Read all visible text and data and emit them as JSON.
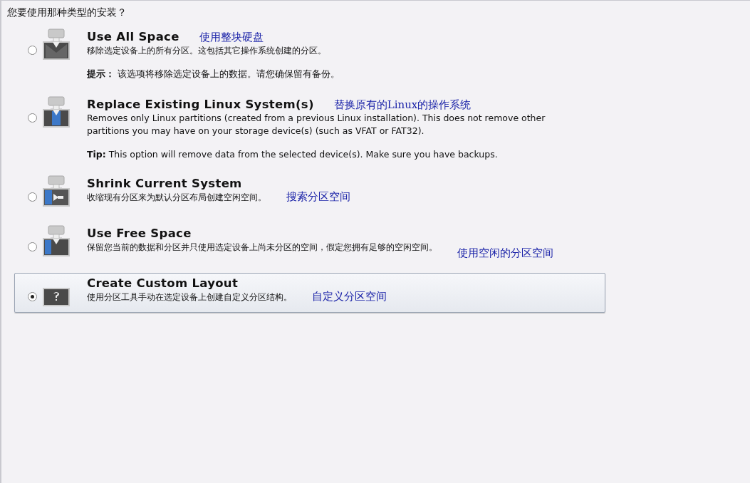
{
  "heading": "您要使用那种类型的安装？",
  "options": [
    {
      "kind": "use_all",
      "title": "Use All Space",
      "annotation": "使用整块硬盘",
      "description": "移除选定设备上的所有分区。这包括其它操作系统创建的分区。",
      "tip": "**提示：** 该选项将移除选定设备上的数据。请您确保留有备份。",
      "selected": false
    },
    {
      "kind": "replace",
      "title": "Replace Existing Linux System(s)",
      "annotation": "替换原有的Linux的操作系统",
      "description": "Removes only Linux partitions (created from a previous Linux installation).  This does not remove other partitions you may have on your storage device(s) (such as VFAT or FAT32).",
      "tip": "**Tip:** This option will remove data from the selected device(s).  Make sure you have backups.",
      "selected": false
    },
    {
      "kind": "shrink",
      "title": "Shrink Current System",
      "annotation": "搜索分区空间",
      "description": "收缩现有分区来为默认分区布局创建空闲空间。",
      "selected": false
    },
    {
      "kind": "free",
      "title": "Use Free Space",
      "annotation": "使用空闲的分区空间",
      "description": "保留您当前的数据和分区并只使用选定设备上尚未分区的空间，假定您拥有足够的空闲空间。",
      "selected": false
    },
    {
      "kind": "custom",
      "title": "Create Custom Layout",
      "annotation": "自定义分区空间",
      "description": "使用分区工具手动在选定设备上创建自定义分区结构。",
      "selected": true
    }
  ]
}
